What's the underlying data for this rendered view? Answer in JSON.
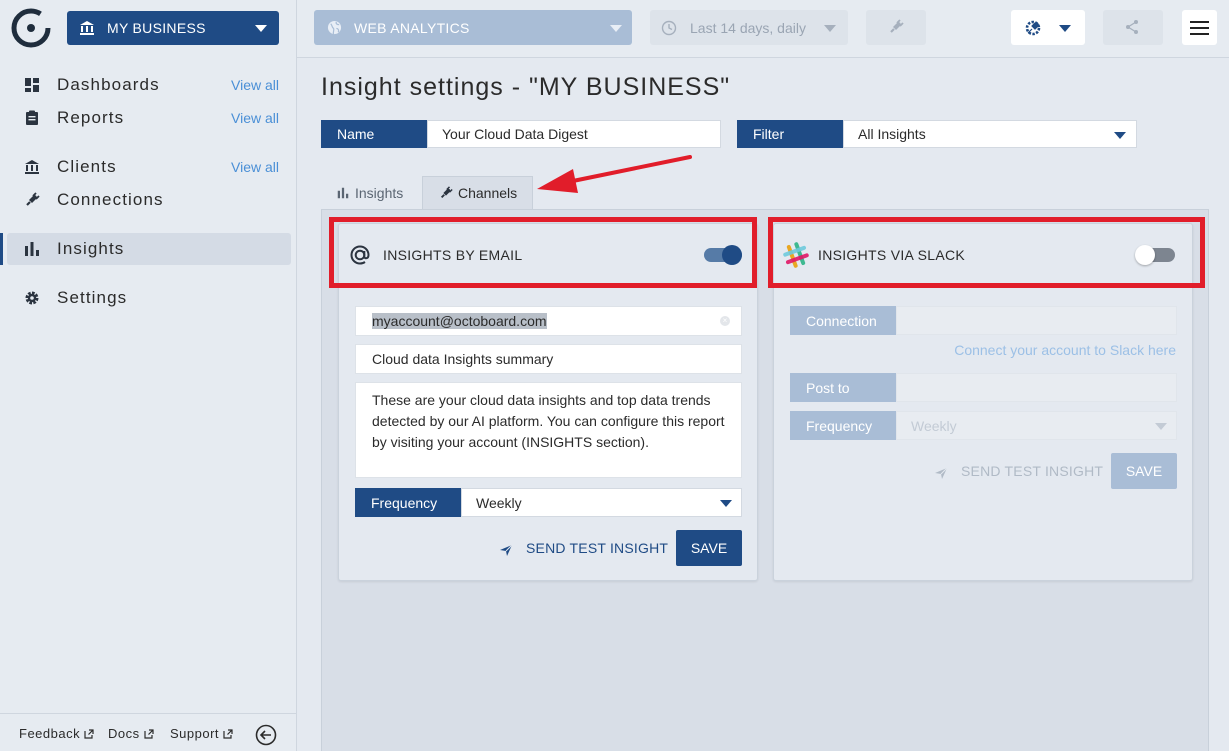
{
  "sidebar": {
    "business_name": "MY BUSINESS",
    "items": [
      {
        "label": "Dashboards",
        "view_all": "View all",
        "icon": "dashboard-icon"
      },
      {
        "label": "Reports",
        "view_all": "View all",
        "icon": "clipboard-icon"
      },
      {
        "label": "Clients",
        "view_all": "View all",
        "icon": "bank-icon"
      },
      {
        "label": "Connections",
        "icon": "plug-icon"
      },
      {
        "label": "Insights",
        "icon": "bar-chart-icon",
        "active": true
      },
      {
        "label": "Settings",
        "icon": "gear-icon"
      }
    ],
    "footer": {
      "feedback": "Feedback",
      "docs": "Docs",
      "support": "Support"
    }
  },
  "topbar": {
    "datasource": "WEB ANALYTICS",
    "date_range": "Last 14 days, daily"
  },
  "main": {
    "title": "Insight settings - \"MY BUSINESS\"",
    "name_label": "Name",
    "name_value": "Your Cloud Data Digest",
    "filter_label": "Filter",
    "filter_value": "All Insights",
    "tabs": [
      {
        "label": "Insights",
        "icon": "bar-chart-icon"
      },
      {
        "label": "Channels",
        "icon": "plug-icon",
        "active": true
      }
    ]
  },
  "email_card": {
    "title": "INSIGHTS BY EMAIL",
    "enabled": true,
    "email": "myaccount@octoboard.com",
    "subject": "Cloud data Insights summary",
    "body": "These are your cloud data insights and top data trends detected by our AI platform. You can configure this report by visiting your account (INSIGHTS section).",
    "frequency_label": "Frequency",
    "frequency_value": "Weekly",
    "send_test": "SEND TEST INSIGHT",
    "save": "SAVE"
  },
  "slack_card": {
    "title": "INSIGHTS VIA SLACK",
    "enabled": false,
    "connection_label": "Connection",
    "connect_link": "Connect your account to Slack here",
    "post_to_label": "Post to",
    "frequency_label": "Frequency",
    "frequency_value": "Weekly",
    "send_test": "SEND TEST INSIGHT",
    "save": "SAVE"
  },
  "colors": {
    "brand_navy": "#1f4b85",
    "link_blue": "#4a8fd6",
    "annotation_red": "#e11d2a",
    "disabled_blue": "#a9bdd6"
  }
}
